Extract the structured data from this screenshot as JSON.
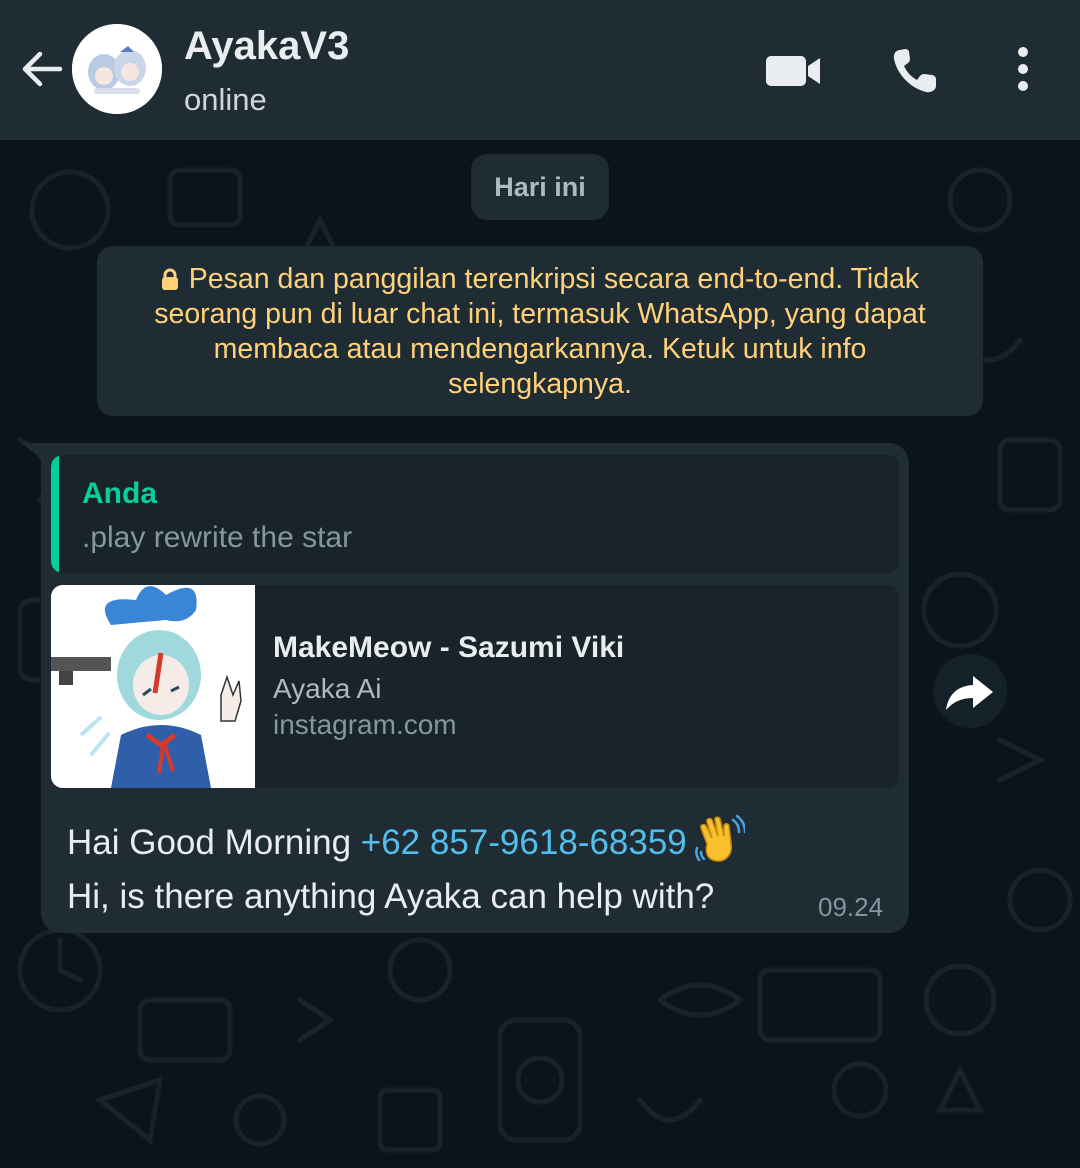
{
  "header": {
    "contact_name": "AyakaV3",
    "status": "online",
    "icons": [
      "back-arrow-icon",
      "video-call-icon",
      "voice-call-icon",
      "more-options-icon"
    ]
  },
  "chat": {
    "date_chip": "Hari ini",
    "encryption_notice": "Pesan dan panggilan terenkripsi secara end-to-end. Tidak seorang pun di luar chat ini, termasuk WhatsApp, yang dapat membaca atau mendengarkannya. Ketuk untuk info selengkapnya.",
    "message": {
      "quote_author": "Anda",
      "quote_text": ".play rewrite the star",
      "link_title": "MakeMeow - Sazumi Viki",
      "link_description": "Ayaka Ai",
      "link_domain": "instagram.com",
      "text_greeting": "Hai Good Morning",
      "mention": "+62 857-9618-68359",
      "emoji": "waving-hand",
      "text_line2": "Hi, is there anything Ayaka can help with?",
      "time": "09.24"
    }
  },
  "colors": {
    "header_bg": "#1f2c34",
    "chat_bg": "#0b141a",
    "bubble_bg": "#1f2c34",
    "quote_accent": "#06cf9c",
    "mention": "#53bdeb",
    "notice_text": "#ffd279"
  }
}
